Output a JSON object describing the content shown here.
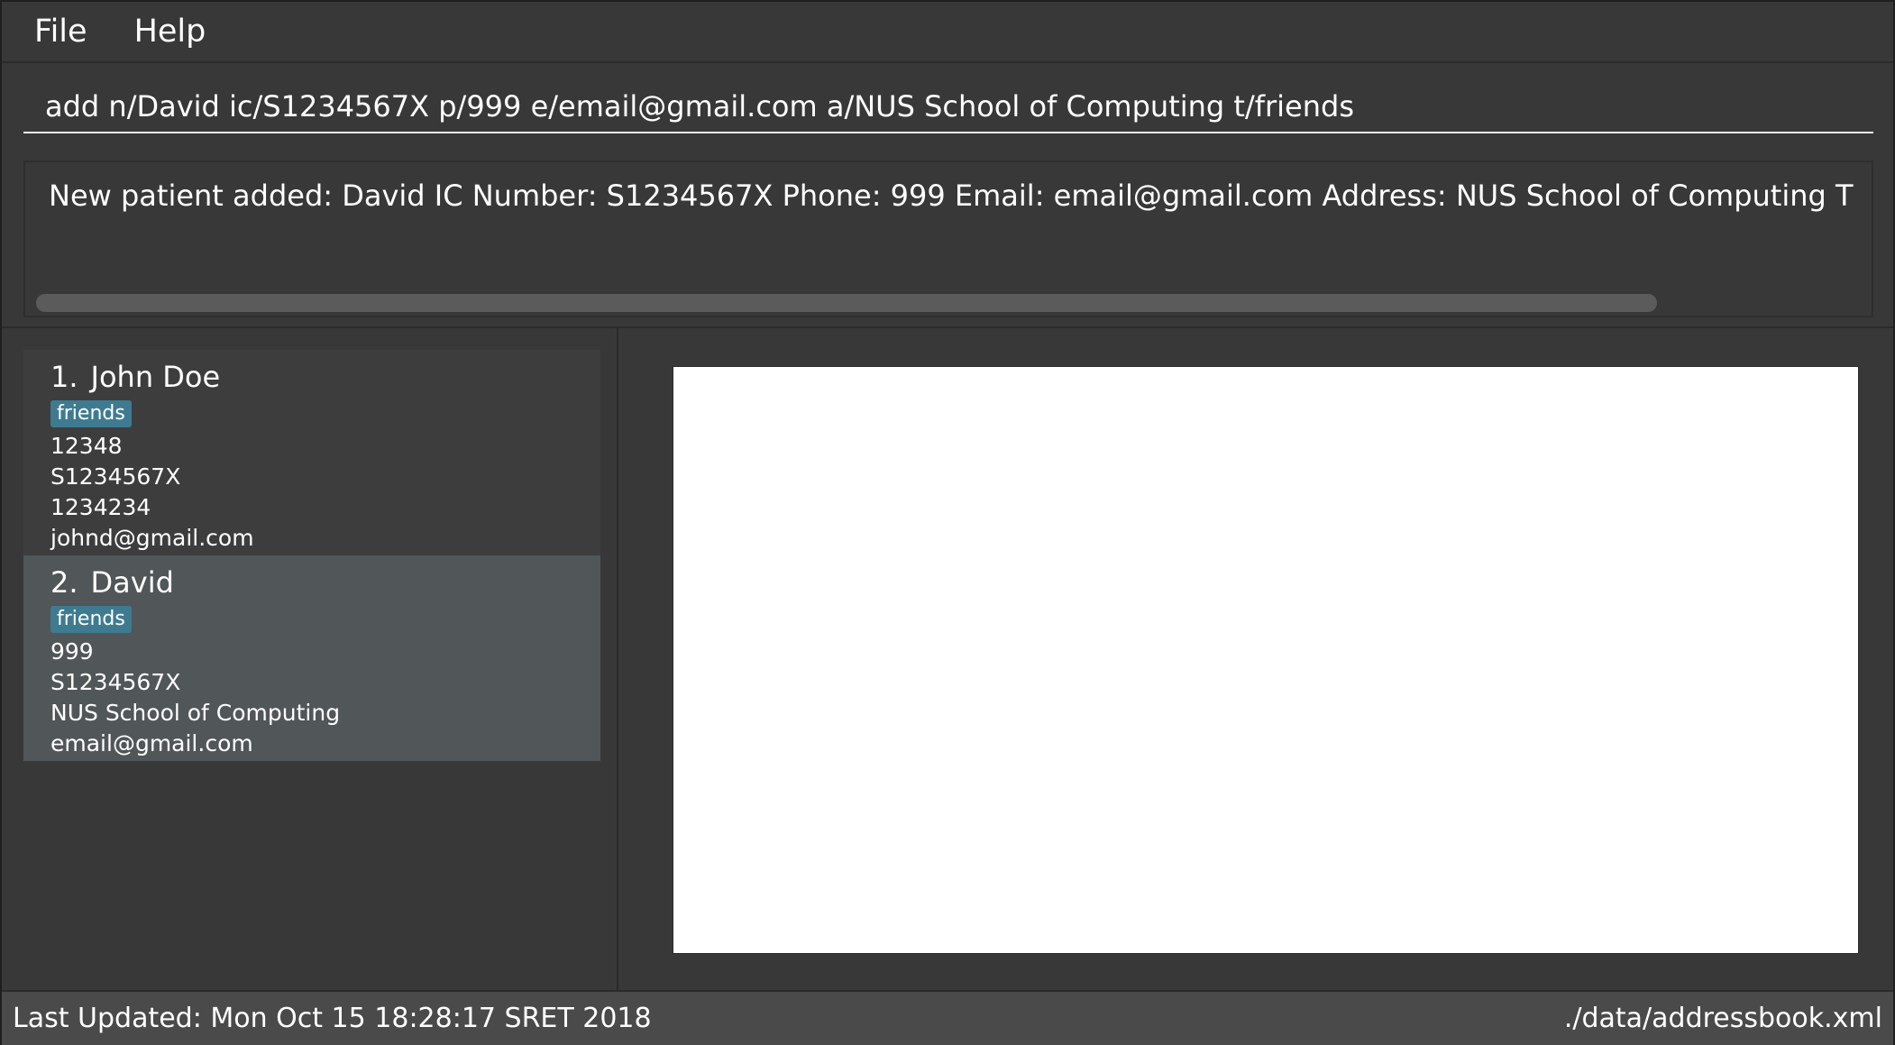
{
  "menu": {
    "file_label": "File",
    "help_label": "Help"
  },
  "command": {
    "value": "add n/David ic/S1234567X p/999 e/email@gmail.com a/NUS School of Computing t/friends"
  },
  "result": {
    "text": "New patient added: David IC Number: S1234567X Phone: 999 Email: email@gmail.com Address: NUS School of Computing T"
  },
  "persons": [
    {
      "index": "1.",
      "name": "John Doe",
      "tag": "friends",
      "lines": [
        "12348",
        "S1234567X",
        "1234234",
        "johnd@gmail.com"
      ]
    },
    {
      "index": "2.",
      "name": "David",
      "tag": "friends",
      "lines": [
        "999",
        "S1234567X",
        "NUS School of Computing",
        "email@gmail.com"
      ]
    }
  ],
  "status": {
    "last_updated": "Last Updated: Mon Oct 15 18:28:17 SRET 2018",
    "file_path": "./data/addressbook.xml"
  },
  "colors": {
    "background": "#383838",
    "tag": "#3e7b91",
    "selected_card": "#515658",
    "browser": "#ffffff"
  }
}
